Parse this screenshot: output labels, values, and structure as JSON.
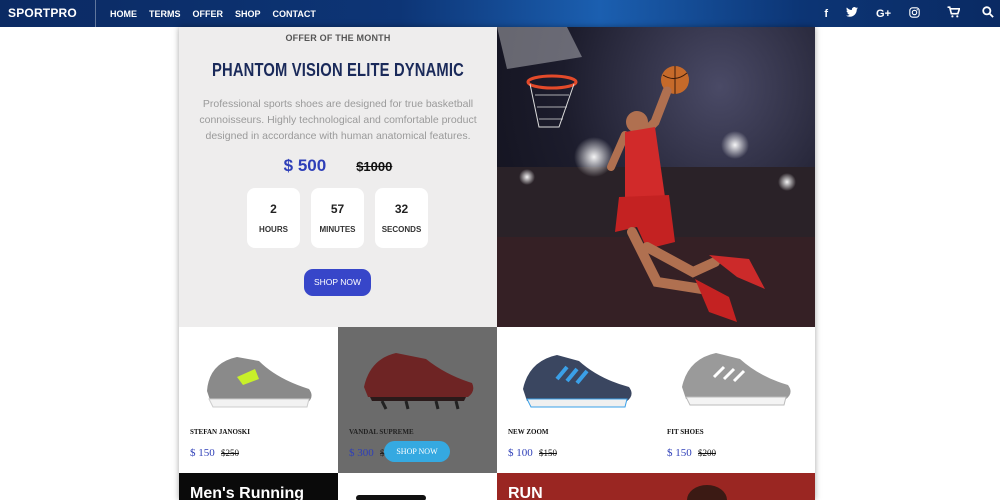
{
  "brand": "SPORTPRO",
  "nav": [
    "HOME",
    "TERMS",
    "OFFER",
    "SHOP",
    "CONTACT"
  ],
  "social_icons": [
    "facebook-icon",
    "twitter-icon",
    "google-plus-icon",
    "instagram-icon"
  ],
  "social_glyphs": [
    "f",
    "t",
    "G+",
    "◎"
  ],
  "utils": {
    "cart_icon": "cart-icon",
    "search_icon": "search-icon"
  },
  "offer": {
    "kicker": "OFFER OF THE MONTH",
    "title": "PHANTOM VISION ELITE DYNAMIC",
    "description": "Professional sports shoes are designed for true basketball connoisseurs. Highly technological and comfortable product designed in accordance with human anatomical features.",
    "price_new": "$ 500",
    "price_old": "$1000",
    "countdown": [
      {
        "value": "2",
        "label": "HOURS"
      },
      {
        "value": "57",
        "label": "MINUTES"
      },
      {
        "value": "32",
        "label": "SECONDS"
      }
    ],
    "cta": "SHOP NOW"
  },
  "products": [
    {
      "name": "STEFAN JANOSKI",
      "price": "$ 150",
      "old_price": "$250"
    },
    {
      "name": "VANDAL SUPREME",
      "price": "$ 300",
      "old_price": "$",
      "cta": "SHOP NOW"
    },
    {
      "name": "NEW ZOOM",
      "price": "$ 100",
      "old_price": "$150"
    },
    {
      "name": "FIT SHOES",
      "price": "$ 150",
      "old_price": "$200"
    }
  ],
  "banners": {
    "left_title": "Men's Running",
    "right_title": "RUN"
  },
  "colors": {
    "accent": "#3746c9",
    "nav_bg": "#0d3576",
    "overlay_button": "#35a9e1",
    "banner_red": "#9a2622"
  }
}
